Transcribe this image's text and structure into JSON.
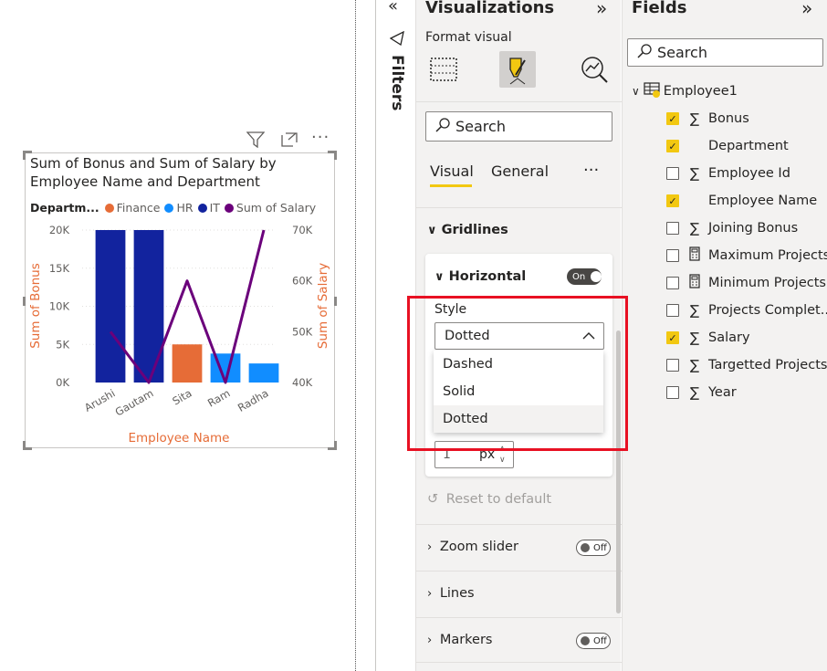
{
  "visual": {
    "title": "Sum of Bonus and Sum of Salary by Employee Name and Department",
    "legend_title": "Departm...",
    "legend": [
      {
        "label": "Finance",
        "color": "#e66c37"
      },
      {
        "label": "HR",
        "color": "#118dff"
      },
      {
        "label": "IT",
        "color": "#12239e"
      },
      {
        "label": "Sum of Salary",
        "color": "#6b007b"
      }
    ],
    "header_icons": [
      "filter-icon",
      "focus-mode-icon",
      "more-options-icon"
    ]
  },
  "chart_data": {
    "type": "bar",
    "categories": [
      "Arushi",
      "Gautam",
      "Sita",
      "Ram",
      "Radha"
    ],
    "series": [
      {
        "name": "Sum of Bonus",
        "values": [
          20000,
          20000,
          5000,
          3800,
          2500
        ],
        "colors": [
          "#12239e",
          "#12239e",
          "#e66c37",
          "#118dff",
          "#118dff"
        ]
      },
      {
        "name": "Sum of Salary",
        "type": "line",
        "values": [
          50000,
          40000,
          60000,
          40000,
          70000
        ],
        "color": "#6b007b"
      }
    ],
    "xlabel": "Employee Name",
    "ylabel": "Sum of Bonus",
    "y2label": "Sum of Salary",
    "ylim": [
      0,
      20000
    ],
    "y2lim": [
      40000,
      70000
    ],
    "yticks": [
      "20K",
      "15K",
      "10K",
      "5K",
      "0K"
    ],
    "y2ticks": [
      "70K",
      "60K",
      "50K",
      "40K"
    ],
    "axis_label_color": "#e66c37",
    "grid": "dotted"
  },
  "filters": {
    "label": "Filters"
  },
  "viz_pane": {
    "title": "Visualizations",
    "format_visual": "Format visual",
    "search_placeholder": "Search",
    "tab_visual": "Visual",
    "tab_general": "General",
    "more": "···",
    "gridlines": "Gridlines",
    "horizontal": "Horizontal",
    "horizontal_toggle": "On",
    "style_label": "Style",
    "style_value": "Dotted",
    "style_options": [
      "Dashed",
      "Solid",
      "Dotted"
    ],
    "width_value": "1",
    "width_unit": "px",
    "reset": "Reset to default",
    "zoom_slider": "Zoom slider",
    "zoom_toggle": "Off",
    "lines": "Lines",
    "markers": "Markers",
    "markers_toggle": "Off"
  },
  "fields_pane": {
    "title": "Fields",
    "search_placeholder": "Search",
    "table": "Employee1",
    "fields": [
      {
        "label": "Bonus",
        "checked": true,
        "icon": "sigma"
      },
      {
        "label": "Department",
        "checked": true,
        "icon": ""
      },
      {
        "label": "Employee Id",
        "checked": false,
        "icon": "sigma"
      },
      {
        "label": "Employee Name",
        "checked": true,
        "icon": ""
      },
      {
        "label": "Joining Bonus",
        "checked": false,
        "icon": "sigma"
      },
      {
        "label": "Maximum Projects",
        "checked": false,
        "icon": "calc"
      },
      {
        "label": "Minimum Projects",
        "checked": false,
        "icon": "calc"
      },
      {
        "label": "Projects Complet...",
        "checked": false,
        "icon": "sigma"
      },
      {
        "label": "Salary",
        "checked": true,
        "icon": "sigma"
      },
      {
        "label": "Targetted Projects",
        "checked": false,
        "icon": "sigma"
      },
      {
        "label": "Year",
        "checked": false,
        "icon": "sigma"
      }
    ]
  }
}
